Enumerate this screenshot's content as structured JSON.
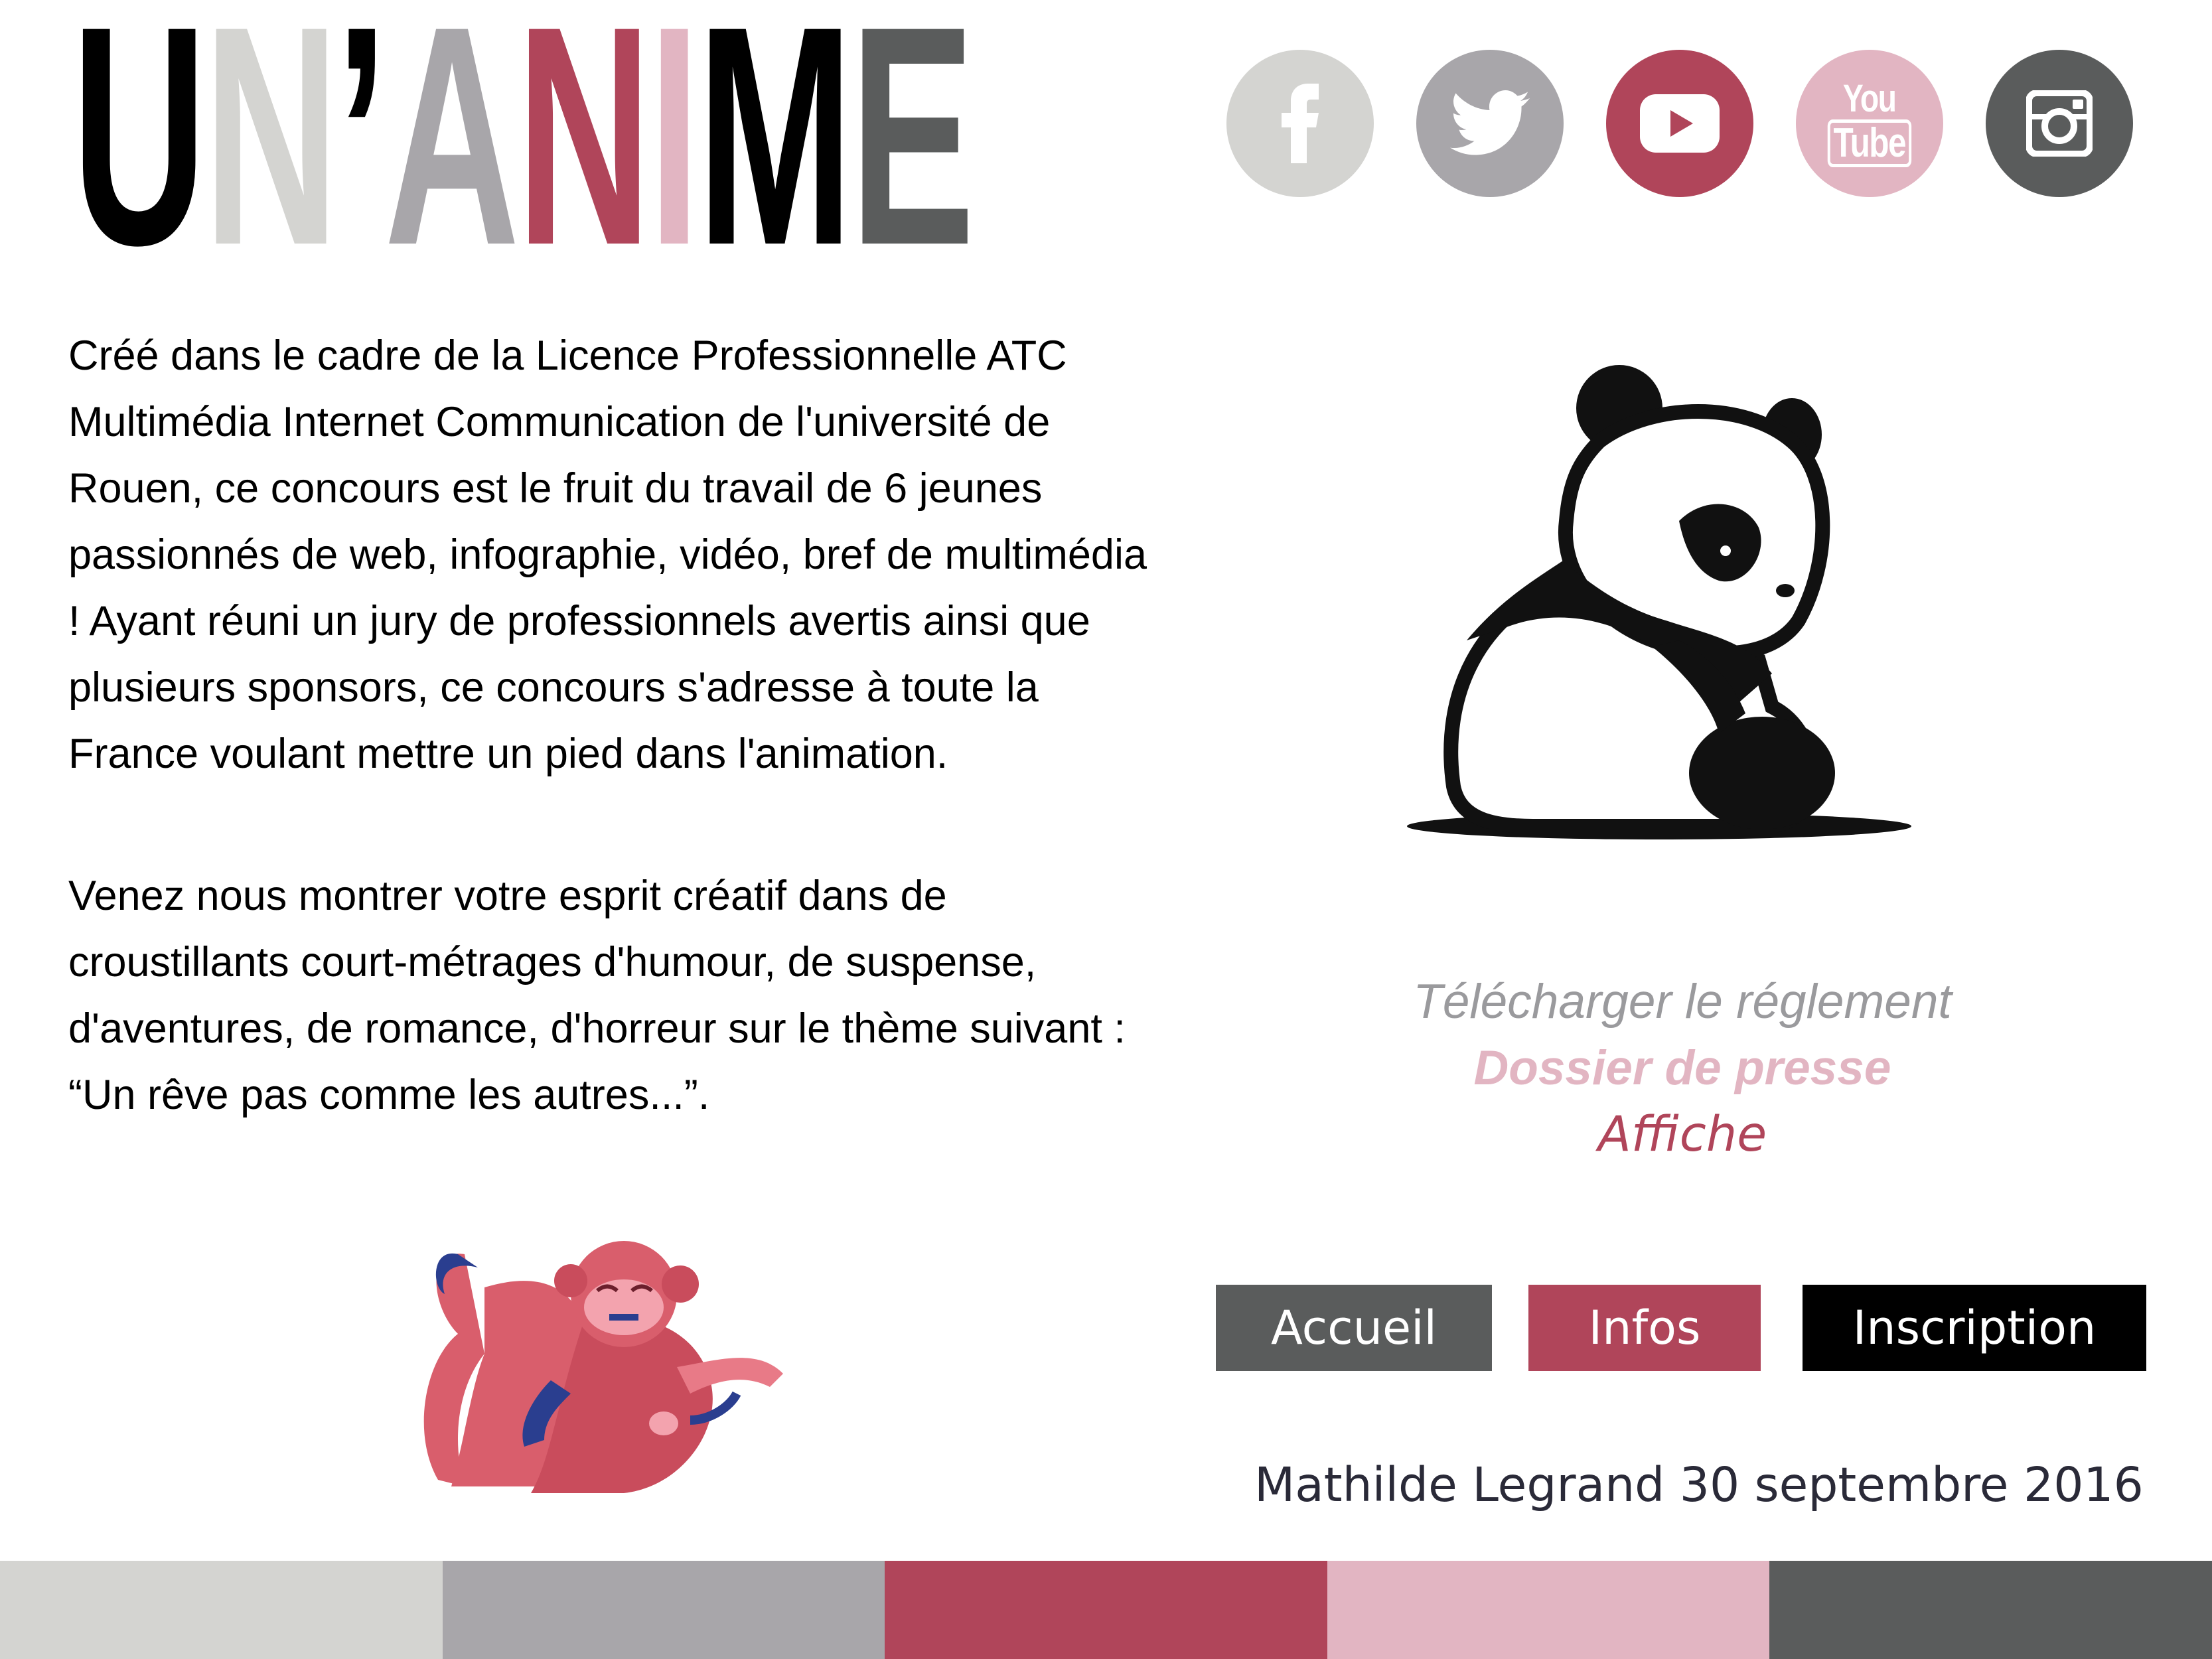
{
  "logo": {
    "letters": [
      {
        "char": "U",
        "color": "#000000"
      },
      {
        "char": "N",
        "color": "#d4d4d1"
      },
      {
        "char": "’",
        "color": "#000000"
      },
      {
        "char": "A",
        "color": "#a8a6aa"
      },
      {
        "char": "N",
        "color": "#b0455a"
      },
      {
        "char": "I",
        "color": "#e2b5c2"
      },
      {
        "char": "M",
        "color": "#000000"
      },
      {
        "char": "E",
        "color": "#5a5c5c"
      }
    ]
  },
  "socials": [
    {
      "name": "facebook",
      "icon": "facebook-icon",
      "color": "#d4d4d1"
    },
    {
      "name": "twitter",
      "icon": "twitter-icon",
      "color": "#a8a6aa"
    },
    {
      "name": "youtube-play",
      "icon": "youtube-play-icon",
      "color": "#b0455a"
    },
    {
      "name": "youtube",
      "icon": "youtube-logo-icon",
      "color": "#e2b5c2",
      "text_top": "You",
      "text_bottom": "Tube"
    },
    {
      "name": "instagram",
      "icon": "instagram-icon",
      "color": "#5a5c5c"
    }
  ],
  "intro": {
    "paragraph1": "Créé dans le cadre de la Licence Professionnelle ATC Multimédia Internet Communication de l'université de Rouen, ce concours est le fruit du travail de 6 jeunes passionnés de web, infographie, vidéo, bref de multimédia ! Ayant réuni un jury de professionnels avertis ainsi que plusieurs sponsors, ce concours s'adresse à toute la France voulant mettre un pied dans l'animation.",
    "paragraph2": "Venez nous montrer votre esprit créatif dans de croustillants court-métrages d'humour, de suspense, d'aventures, de romance, d'horreur sur le thème suivant : “Un rêve pas comme les autres...”."
  },
  "links": {
    "rules": "Télécharger le réglement",
    "press": "Dossier de presse",
    "poster": "Affiche"
  },
  "nav": {
    "home": {
      "label": "Accueil",
      "color": "#5a5c5c"
    },
    "info": {
      "label": "Infos",
      "color": "#b0455a"
    },
    "signup": {
      "label": "Inscription",
      "color": "#000000"
    }
  },
  "footer": {
    "author": "Mathilde Legrand 30 septembre 2016"
  },
  "color_bar": [
    "#d4d4d1",
    "#a8a6aa",
    "#b0455a",
    "#e2b5c2",
    "#5a5c5c"
  ]
}
